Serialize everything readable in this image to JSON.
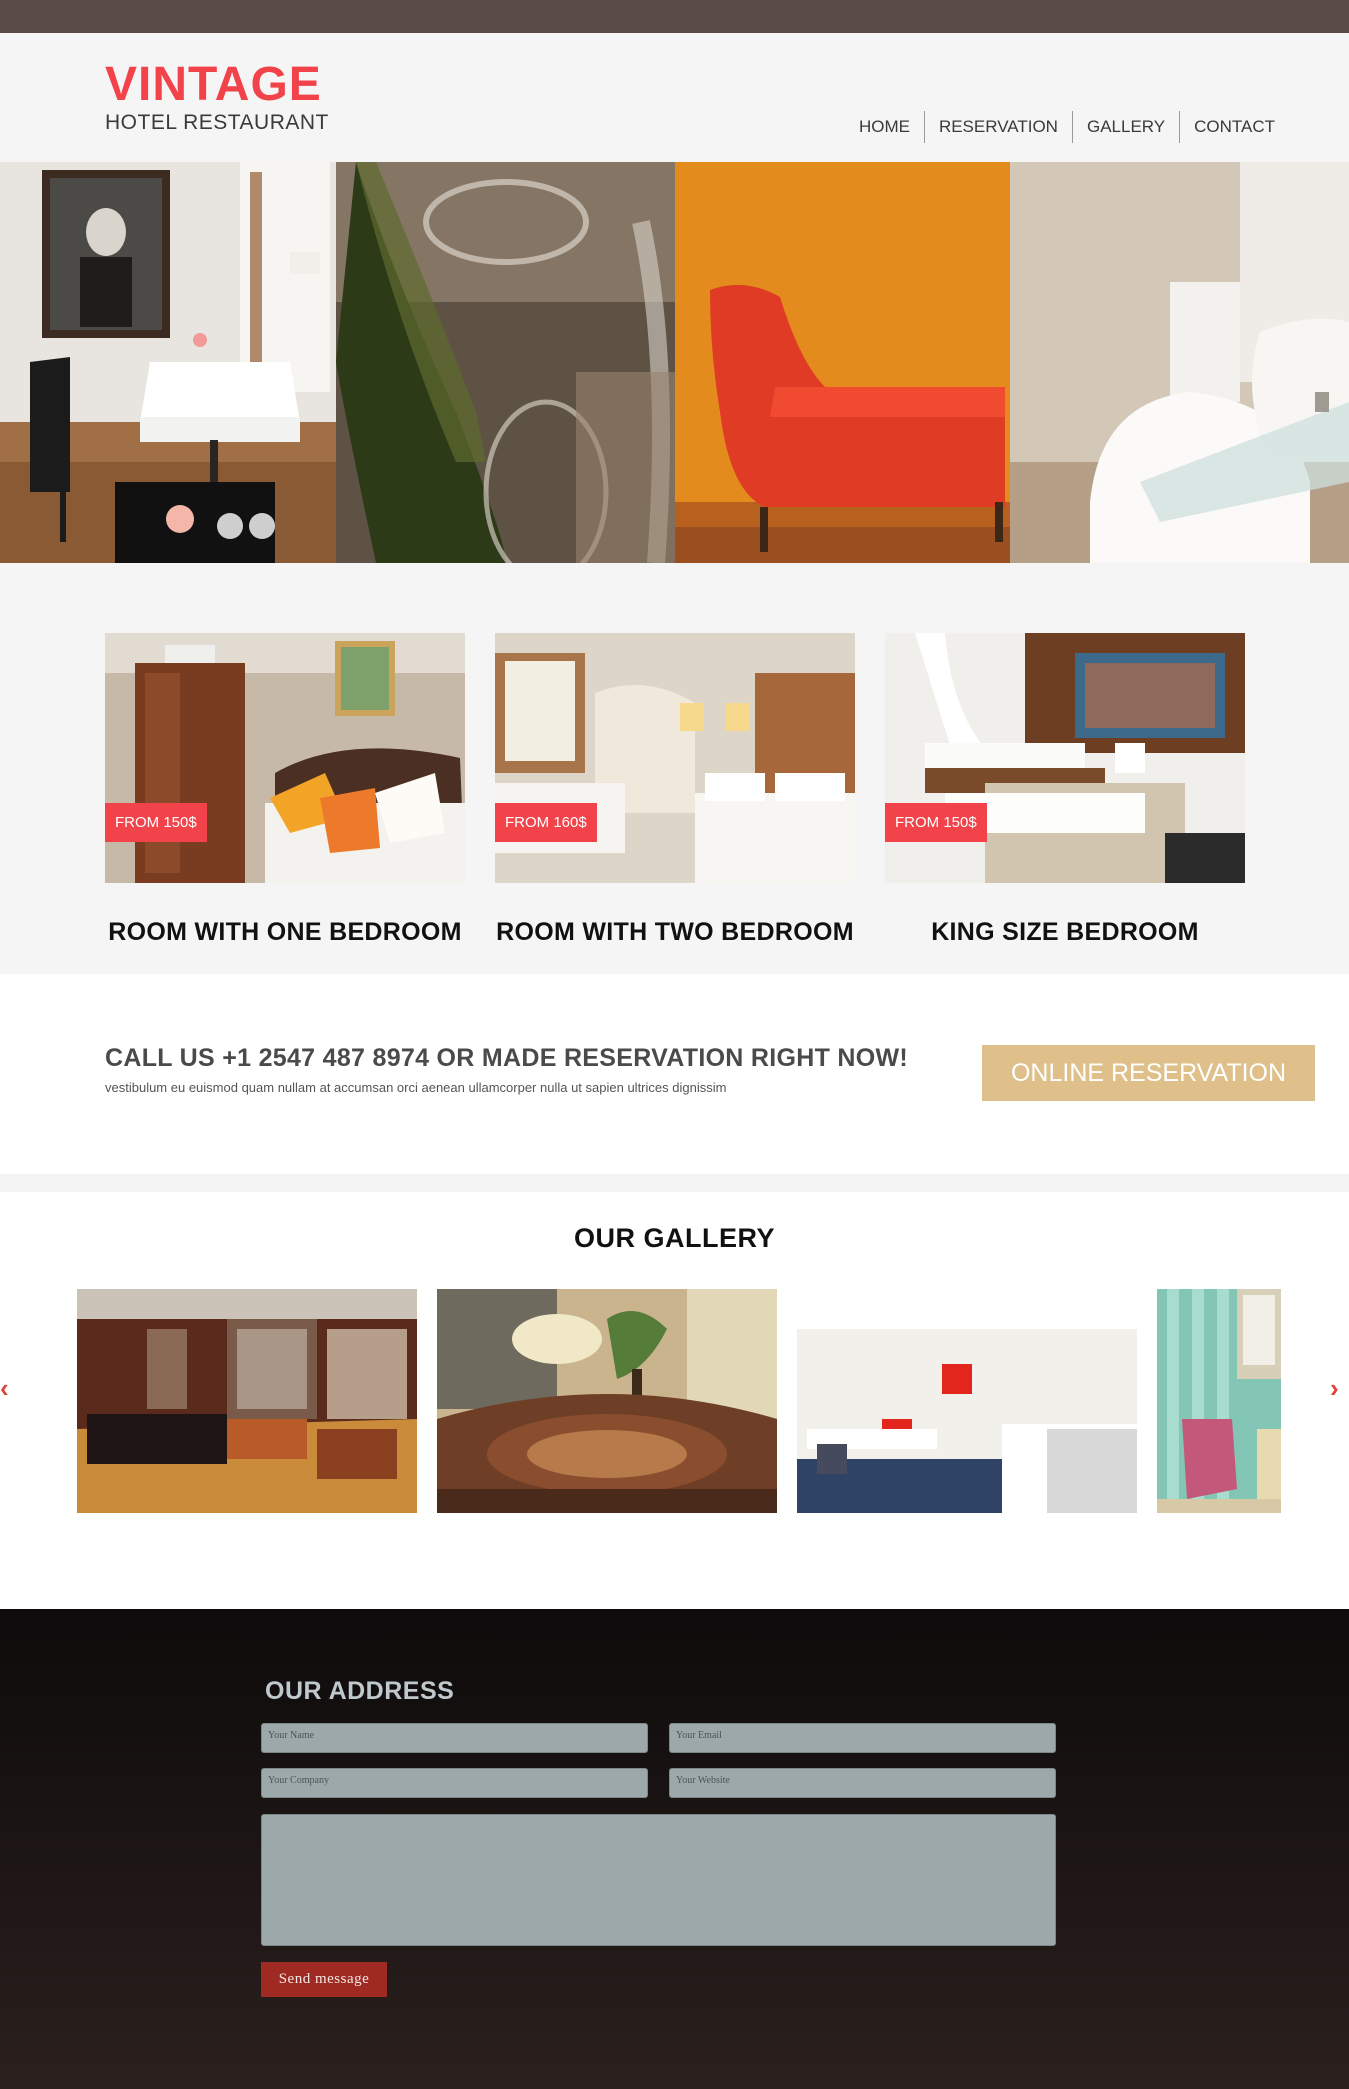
{
  "header": {
    "logo_title": "VINTAGE",
    "logo_subtitle": "HOTEL RESTAURANT",
    "nav": [
      {
        "label": "HOME"
      },
      {
        "label": "RESERVATION"
      },
      {
        "label": "GALLERY"
      },
      {
        "label": "CONTACT"
      }
    ]
  },
  "rooms": [
    {
      "price": "FROM 150$",
      "title": "ROOM WITH ONE BEDROOM"
    },
    {
      "price": "FROM 160$",
      "title": "ROOM WITH TWO BEDROOM"
    },
    {
      "price": "FROM 150$",
      "title": "KING SIZE BEDROOM"
    }
  ],
  "cta": {
    "title": "CALL US +1 2547 487 8974 OR MADE RESERVATION RIGHT NOW!",
    "text": "vestibulum eu euismod quam nullam at accumsan orci aenean ullamcorper nulla ut sapien ultrices dignissim",
    "button": "ONLINE RESERVATION"
  },
  "gallery": {
    "title": "OUR GALLERY",
    "prev_icon": "chevron-left-icon",
    "next_icon": "chevron-right-icon"
  },
  "footer": {
    "title": "OUR ADDRESS",
    "name_placeholder": "Your Name",
    "email_placeholder": "Your Email",
    "company_placeholder": "Your Company",
    "website_placeholder": "Your Website",
    "send_label": "Send message"
  },
  "colors": {
    "accent_red": "#f2434b",
    "gold_button": "#dfc08a",
    "topbar": "#5a4b47",
    "send_button": "#9e2a21"
  }
}
